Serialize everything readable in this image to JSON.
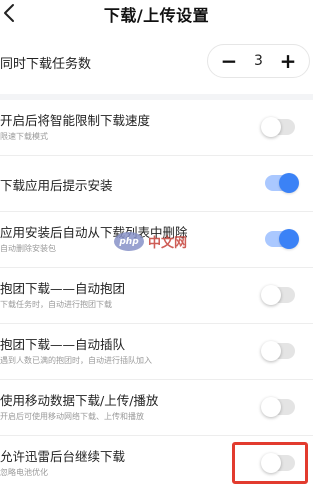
{
  "header": {
    "title": "下载/上传设置",
    "back_icon": "chevron-left-icon"
  },
  "concurrent": {
    "label": "同时下载任务数",
    "value": "3",
    "minus_symbol": "−",
    "plus_symbol": "+"
  },
  "settings": [
    {
      "title": "开启后将智能限制下载速度",
      "subtitle": "限速下载模式",
      "enabled": false
    },
    {
      "title": "下载应用后提示安装",
      "subtitle": "",
      "enabled": true
    },
    {
      "title": "应用安装后自动从下载列表中删除",
      "subtitle": "自动删除安装包",
      "enabled": true
    },
    {
      "title": "抱团下载——自动抱团",
      "subtitle": "下载任务时，自动进行抱团下载",
      "enabled": false
    },
    {
      "title": "抱团下载——自动插队",
      "subtitle": "遇到人数已满的抱团时，自动进行插队加入",
      "enabled": false
    },
    {
      "title": "使用移动数据下载/上传/播放",
      "subtitle": "开启后可使用移动网络下载、上传和播放",
      "enabled": false
    },
    {
      "title": "允许迅雷后台继续下载",
      "subtitle": "忽略电池优化",
      "enabled": false
    }
  ],
  "watermark": {
    "logo_text": "php",
    "site_text": "中文网"
  },
  "colors": {
    "accent": "#3b82f6",
    "toggle_on_track": "#aac8ff",
    "toggle_off_track": "#e4e4e4",
    "highlight": "#e23b2e"
  }
}
